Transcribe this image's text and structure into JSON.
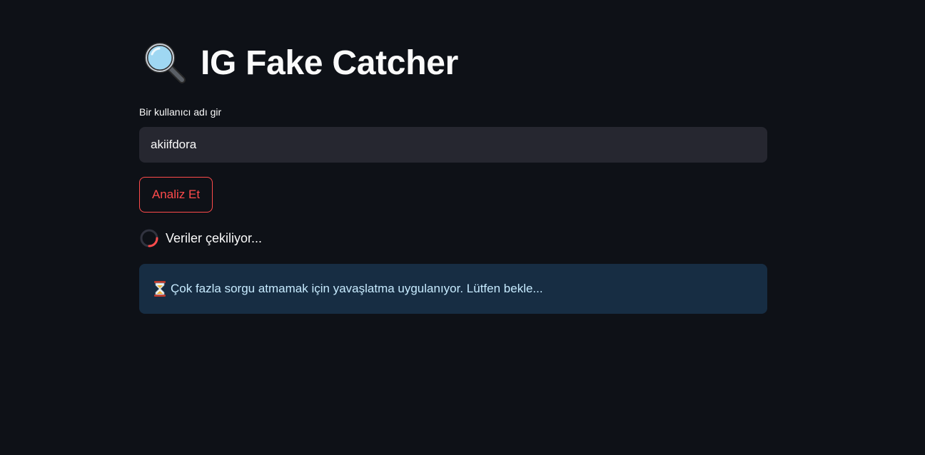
{
  "header": {
    "title": "IG Fake Catcher",
    "title_icon": "magnifying-glass-icon"
  },
  "form": {
    "username_label": "Bir kullanıcı adı gir",
    "username_value": "akiifdora",
    "analyze_button_label": "Analiz Et"
  },
  "status": {
    "spinner_text": "Veriler çekiliyor...",
    "info_icon": "hourglass-icon",
    "info_message": "Çok fazla sorgu atmamak için yavaşlatma uygulanıyor. Lütfen bekle..."
  },
  "colors": {
    "background": "#0e1117",
    "accent": "#ff4b4b",
    "input_bg": "#262730",
    "info_bg": "#172d43",
    "info_text": "#c7ebff"
  }
}
